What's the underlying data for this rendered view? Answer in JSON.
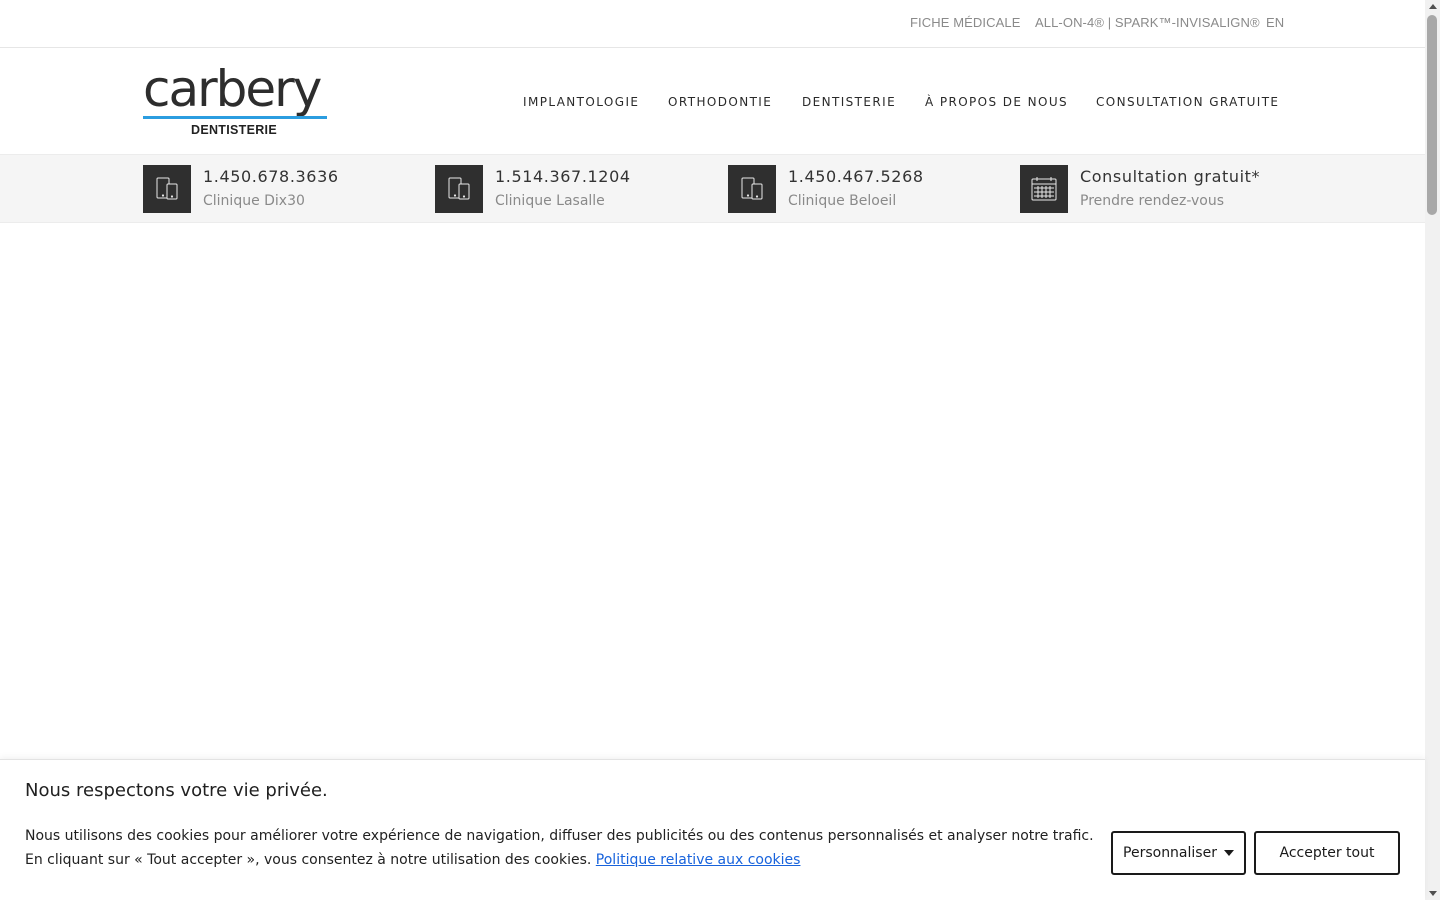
{
  "topbar": {
    "links": [
      "FICHE MÉDICALE",
      "ALL-ON-4® | SPARK™-INVISALIGN®",
      "EN"
    ]
  },
  "logo": {
    "word": "carbery",
    "sub": "DENTISTERIE",
    "accent_color": "#2b9de0"
  },
  "nav": {
    "items": [
      "IMPLANTOLOGIE",
      "ORTHODONTIE",
      "DENTISTERIE",
      "À PROPOS DE NOUS",
      "CONSULTATION GRATUITE"
    ]
  },
  "contacts": [
    {
      "icon": "mobile-tablet-icon",
      "main": "1.450.678.3636",
      "sub": "Clinique Dix30"
    },
    {
      "icon": "mobile-tablet-icon",
      "main": "1.514.367.1204",
      "sub": "Clinique Lasalle"
    },
    {
      "icon": "mobile-tablet-icon",
      "main": "1.450.467.5268",
      "sub": "Clinique Beloeil"
    },
    {
      "icon": "calendar-icon",
      "main": "Consultation gratuit*",
      "sub": "Prendre rendez-vous"
    }
  ],
  "cookie": {
    "title": "Nous respectons votre vie privée.",
    "text": "Nous utilisons des cookies pour améliorer votre expérience de navigation, diffuser des publicités ou des contenus personnalisés et analyser notre trafic. En cliquant sur « Tout accepter », vous consentez à notre utilisation des cookies.",
    "link": "Politique relative aux cookies",
    "customize_label": "Personnaliser",
    "accept_label": "Accepter tout",
    "link_color": "#1863dc"
  }
}
